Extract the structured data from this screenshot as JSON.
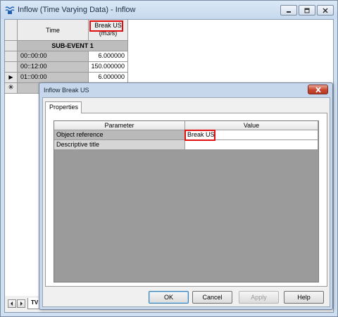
{
  "window": {
    "title": "Inflow (Time Varying Data) - Inflow"
  },
  "grid": {
    "col_time": "Time",
    "col_value_line1": "Break US",
    "col_value_line2": "(m3/s)",
    "subevent": "SUB-EVENT 1",
    "rows": [
      {
        "time": "00::00:00",
        "value": "6.000000",
        "marker": ""
      },
      {
        "time": "00::12:00",
        "value": "150.000000",
        "marker": ""
      },
      {
        "time": "01::00:00",
        "value": "6.000000",
        "marker": "▶"
      }
    ],
    "new_row_marker": "✳",
    "sheet_tab": "TV"
  },
  "dialog": {
    "title": "Inflow Break US",
    "tab": "Properties",
    "col_parameter": "Parameter",
    "col_value": "Value",
    "params": [
      {
        "name": "Object reference",
        "value": "Break US"
      },
      {
        "name": "Descriptive title",
        "value": ""
      }
    ],
    "buttons": {
      "ok": "OK",
      "cancel": "Cancel",
      "apply": "Apply",
      "help": "Help"
    }
  },
  "colors": {
    "highlight": "#e01010",
    "title_bar": "#c6d9ee"
  }
}
